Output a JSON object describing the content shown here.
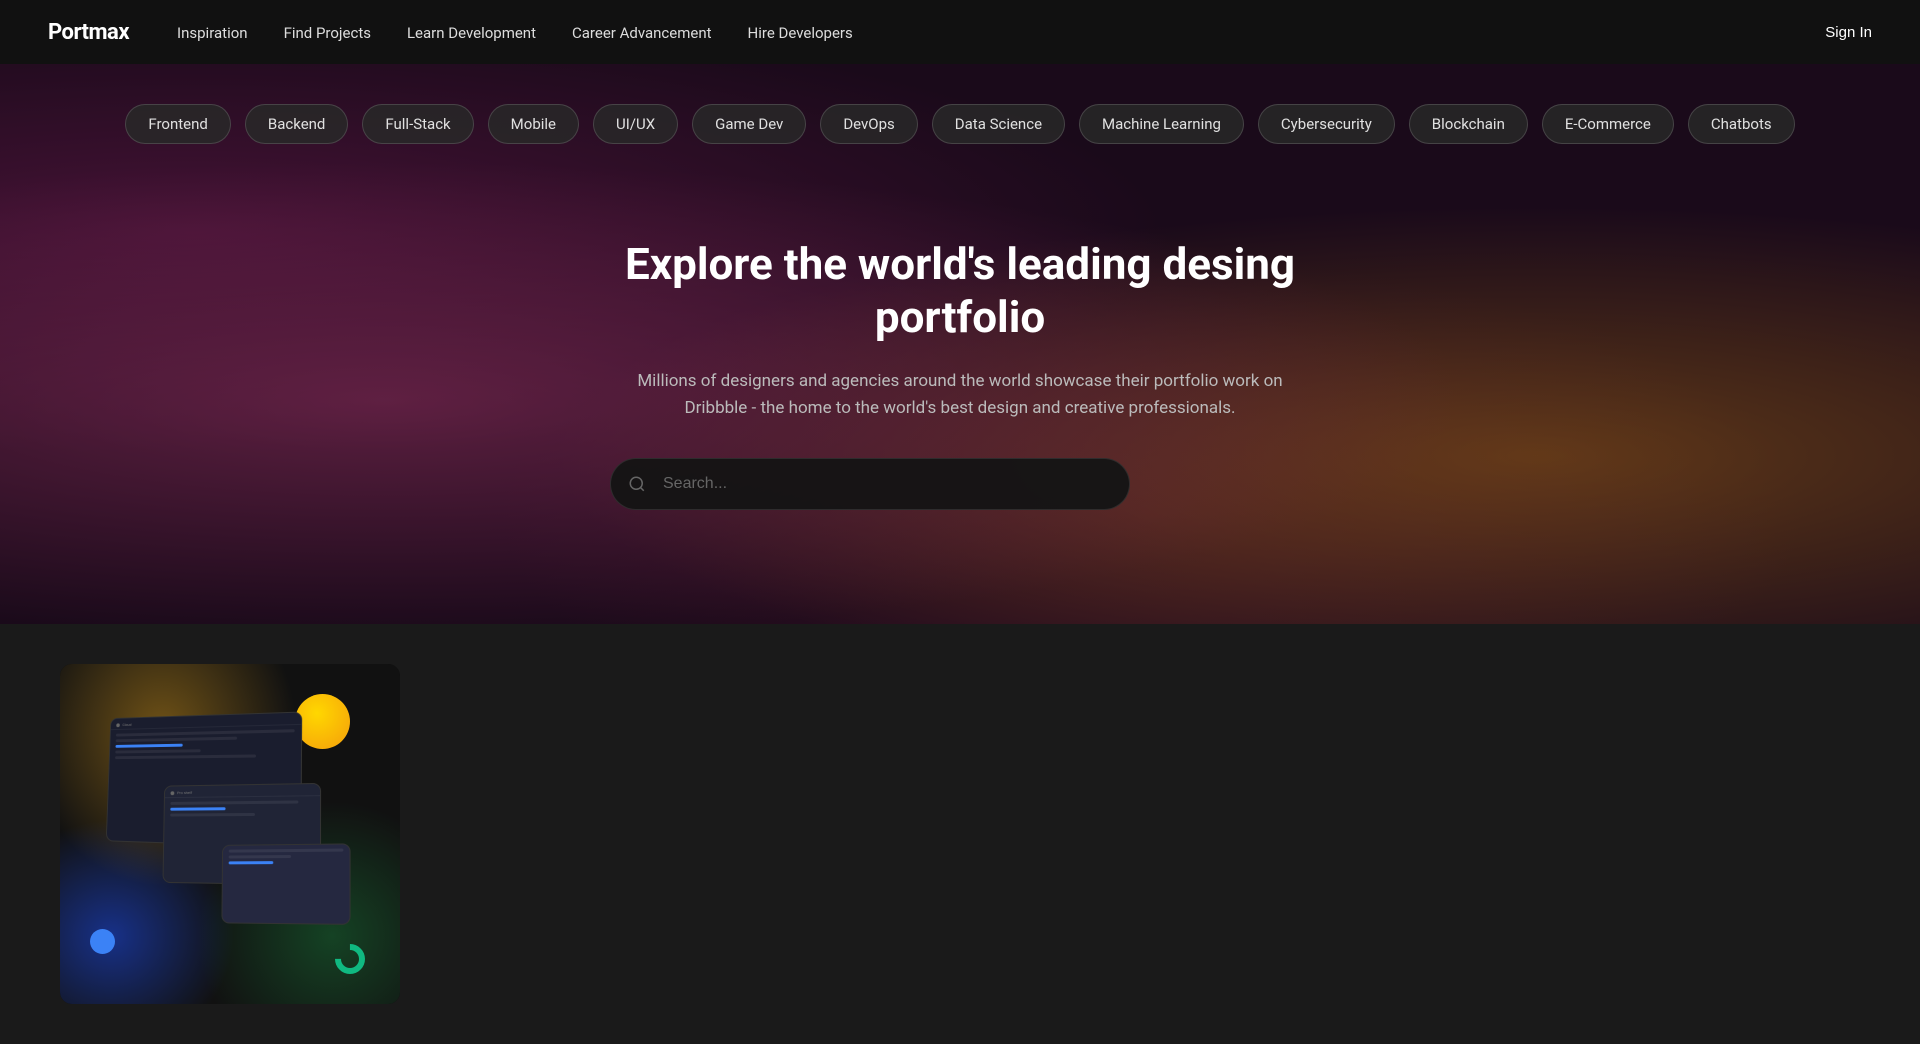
{
  "brand": {
    "logo": "Portmax"
  },
  "navbar": {
    "links": [
      {
        "id": "inspiration",
        "label": "Inspiration"
      },
      {
        "id": "find-projects",
        "label": "Find Projects"
      },
      {
        "id": "learn-development",
        "label": "Learn Development"
      },
      {
        "id": "career-advancement",
        "label": "Career Advancement"
      },
      {
        "id": "hire-developers",
        "label": "Hire Developers"
      }
    ],
    "sign_in": "Sign In"
  },
  "categories": [
    {
      "id": "frontend",
      "label": "Frontend"
    },
    {
      "id": "backend",
      "label": "Backend"
    },
    {
      "id": "full-stack",
      "label": "Full-Stack"
    },
    {
      "id": "mobile",
      "label": "Mobile"
    },
    {
      "id": "ui-ux",
      "label": "UI/UX"
    },
    {
      "id": "game-dev",
      "label": "Game Dev"
    },
    {
      "id": "devops",
      "label": "DevOps"
    },
    {
      "id": "data-science",
      "label": "Data Science"
    },
    {
      "id": "machine-learning",
      "label": "Machine Learning"
    },
    {
      "id": "cybersecurity",
      "label": "Cybersecurity"
    },
    {
      "id": "blockchain",
      "label": "Blockchain"
    },
    {
      "id": "e-commerce",
      "label": "E-Commerce"
    },
    {
      "id": "chatbots",
      "label": "Chatbots"
    }
  ],
  "hero": {
    "title": "Explore the world's leading desing portfolio",
    "subtitle": "Millions of designers and agencies around the world showcase their portfolio work\non Dribbble - the home to the world's best design and creative professionals.",
    "search_placeholder": "Search..."
  }
}
